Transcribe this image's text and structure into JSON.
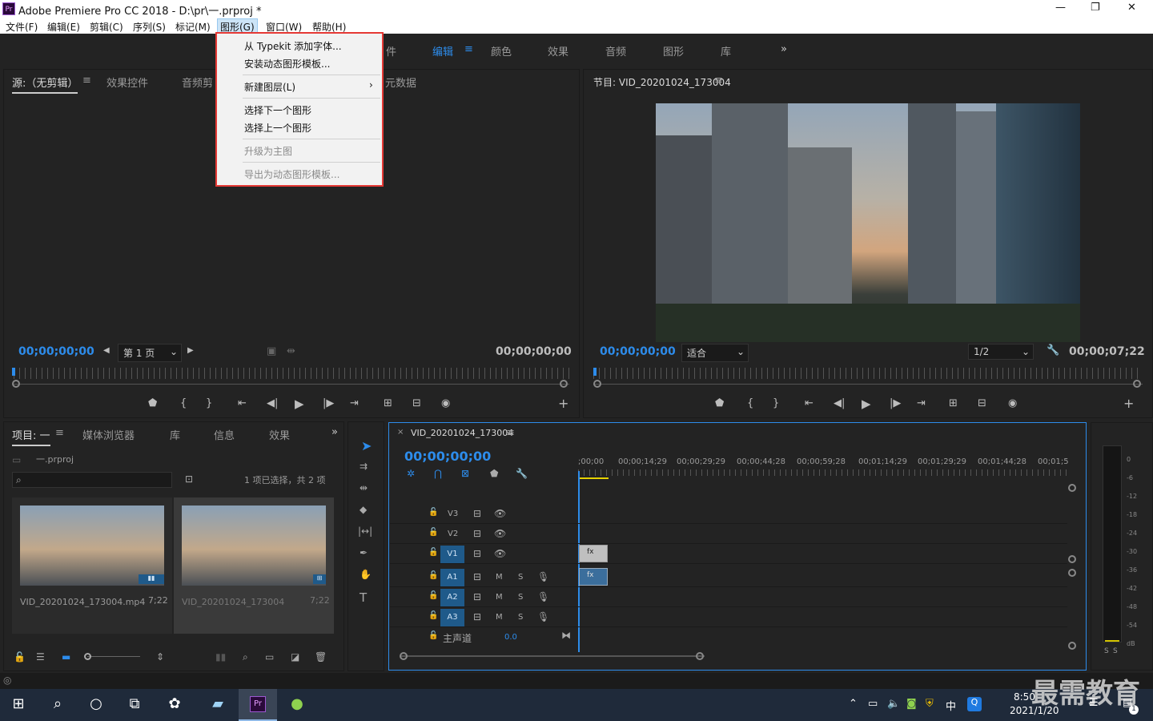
{
  "window": {
    "title": "Adobe Premiere Pro CC 2018 - D:\\pr\\一.prproj *",
    "minimize": "—",
    "maximize": "❐",
    "close": "✕"
  },
  "menubar": {
    "items": [
      "文件(F)",
      "编辑(E)",
      "剪辑(C)",
      "序列(S)",
      "标记(M)",
      "图形(G)",
      "窗口(W)",
      "帮助(H)"
    ]
  },
  "graphics_menu": {
    "items": [
      {
        "label": "从 Typekit 添加字体...",
        "enabled": true
      },
      {
        "label": "安装动态图形模板...",
        "enabled": true
      },
      {
        "label": "新建图层(L)",
        "enabled": true,
        "submenu": "›"
      },
      {
        "label": "选择下一个图形",
        "enabled": true
      },
      {
        "label": "选择上一个图形",
        "enabled": true
      },
      {
        "label": "升级为主图",
        "enabled": false
      },
      {
        "label": "导出为动态图形模板...",
        "enabled": false
      }
    ]
  },
  "workspaces": {
    "items": [
      "件",
      "编辑",
      "颜色",
      "效果",
      "音频",
      "图形",
      "库"
    ],
    "active": "编辑",
    "more": "»"
  },
  "source_panel": {
    "tabs": [
      "源:（无剪辑）",
      "效果控件",
      "音频剪",
      "元数据"
    ],
    "timecode_left": "00;00;00;00",
    "page": "第 1 页",
    "timecode_right": "00;00;00;00"
  },
  "program_panel": {
    "title": "节目: VID_20201024_173004",
    "timecode_left": "00;00;00;00",
    "fit": "适合",
    "resolution": "1/2",
    "timecode_right": "00;00;07;22"
  },
  "project_panel": {
    "tabs": [
      "项目: 一",
      "媒体浏览器",
      "库",
      "信息",
      "效果"
    ],
    "project_file": "一.prproj",
    "selection_info": "1 项已选择，共 2 项",
    "items": [
      {
        "name": "VID_20201024_173004.mp4",
        "duration": "7;22"
      },
      {
        "name": "VID_20201024_173004",
        "duration": "7;22"
      }
    ]
  },
  "timeline": {
    "sequence_name": "VID_20201024_173004",
    "timecode": "00;00;00;00",
    "ruler": [
      ";00;00",
      "00;00;14;29",
      "00;00;29;29",
      "00;00;44;28",
      "00;00;59;28",
      "00;01;14;29",
      "00;01;29;29",
      "00;01;44;28",
      "00;01;5"
    ],
    "video_tracks": [
      "V3",
      "V2",
      "V1"
    ],
    "audio_tracks": [
      "A1",
      "A2",
      "A3"
    ],
    "mute": "M",
    "solo": "S",
    "master_label": "主声道",
    "master_value": "0.0"
  },
  "audio_meter": {
    "scale": [
      "0",
      "-6",
      "-12",
      "-18",
      "-24",
      "-30",
      "-36",
      "-42",
      "-48",
      "-54",
      "dB"
    ],
    "solo_labels": [
      "S",
      "S"
    ]
  },
  "taskbar": {
    "time": "8:50",
    "date": "2021/1/20",
    "ime": "中",
    "watermark": "最需教育",
    "notification_count": "1"
  }
}
